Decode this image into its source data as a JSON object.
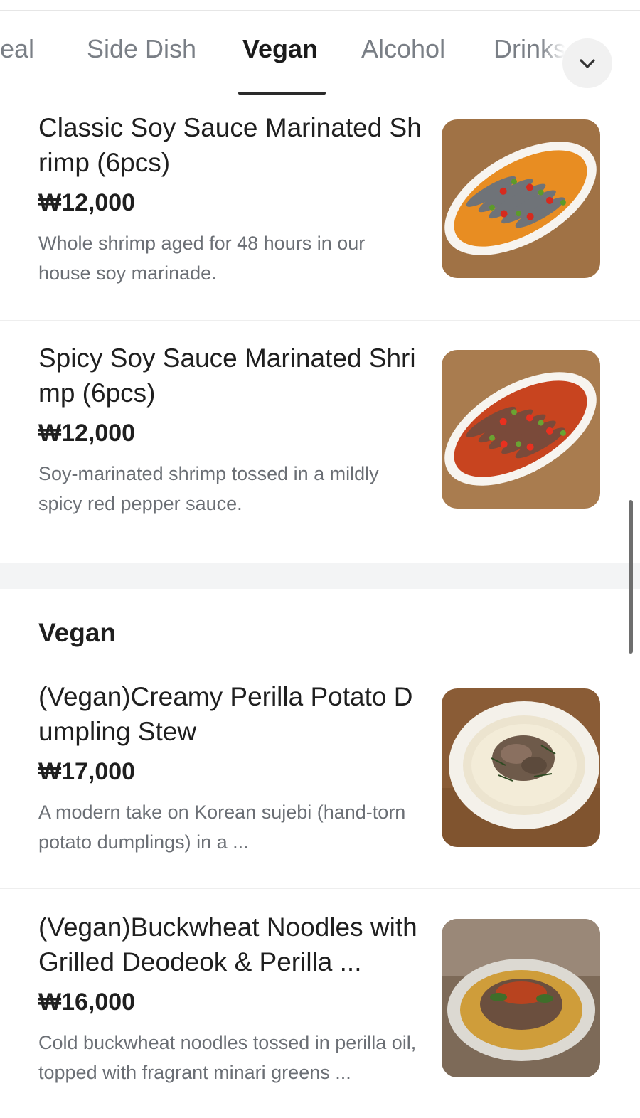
{
  "tabs": [
    {
      "label": "Meal"
    },
    {
      "label": "Side Dish"
    },
    {
      "label": "Vegan"
    },
    {
      "label": "Alcohol"
    },
    {
      "label": "Drinks"
    }
  ],
  "active_tab": "Vegan",
  "expand_icon": "chevron-down-icon",
  "items": [
    {
      "name": "Classic Soy Sauce Marinated Shrimp (6pcs)",
      "price": "₩12,000",
      "description": "Whole shrimp aged for 48 hours in our house soy marinade."
    },
    {
      "name": "Spicy Soy Sauce Marinated Shrimp (6pcs)",
      "price": "₩12,000",
      "description": "Soy-marinated shrimp tossed in a mildly spicy red pepper sauce."
    }
  ],
  "section": {
    "title": "Vegan",
    "items": [
      {
        "name": "(Vegan)Creamy Perilla Potato Dumpling Stew",
        "price": "₩17,000",
        "description": "A modern take on Korean sujebi (hand-torn potato dumplings) in a ..."
      },
      {
        "name": "(Vegan)Buckwheat Noodles with Grilled Deodeok & Perilla ...",
        "price": "₩16,000",
        "description": "Cold buckwheat noodles tossed in perilla oil, topped with fragrant minari greens ..."
      }
    ]
  },
  "colors": {
    "active_tab": "#1b1b1b",
    "inactive_tab": "#7a7f86",
    "description": "#6b6f75",
    "section_gap": "#f3f4f5"
  }
}
